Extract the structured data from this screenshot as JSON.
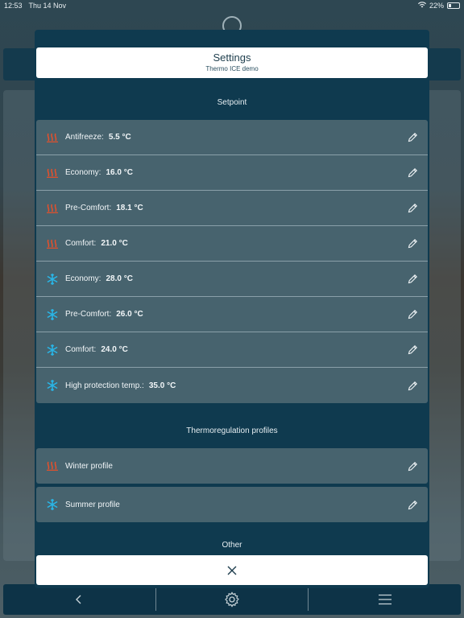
{
  "status_bar": {
    "time": "12:53",
    "date": "Thu 14 Nov",
    "battery": "22%"
  },
  "modal": {
    "title": "Settings",
    "subtitle": "Thermo ICE demo",
    "setpoint_section": "Setpoint",
    "setpoints": [
      {
        "mode": "heat",
        "label": "Antifreeze:",
        "value": "5.5 °C"
      },
      {
        "mode": "heat",
        "label": "Economy:",
        "value": "16.0 °C"
      },
      {
        "mode": "heat",
        "label": "Pre-Comfort:",
        "value": "18.1 °C"
      },
      {
        "mode": "heat",
        "label": "Comfort:",
        "value": "21.0 °C"
      },
      {
        "mode": "cool",
        "label": "Economy:",
        "value": "28.0 °C"
      },
      {
        "mode": "cool",
        "label": "Pre-Comfort:",
        "value": "26.0 °C"
      },
      {
        "mode": "cool",
        "label": "Comfort:",
        "value": "24.0 °C"
      },
      {
        "mode": "cool",
        "label": "High protection temp.:",
        "value": "35.0 °C"
      }
    ],
    "profiles_section": "Thermoregulation profiles",
    "profiles": [
      {
        "mode": "heat",
        "label": "Winter profile"
      },
      {
        "mode": "cool",
        "label": "Summer profile"
      }
    ],
    "other_section": "Other"
  },
  "icons": {
    "heat": "heating-icon",
    "cool": "snowflake-icon",
    "edit": "pencil-icon",
    "close": "close-icon",
    "back": "chevron-left-icon",
    "settings": "gear-icon",
    "menu": "hamburger-menu-icon"
  },
  "colors": {
    "heat": "#e8502a",
    "cool": "#29b6e8",
    "modal_bg": "#0f3a4f",
    "row_bg": "#47636e"
  }
}
